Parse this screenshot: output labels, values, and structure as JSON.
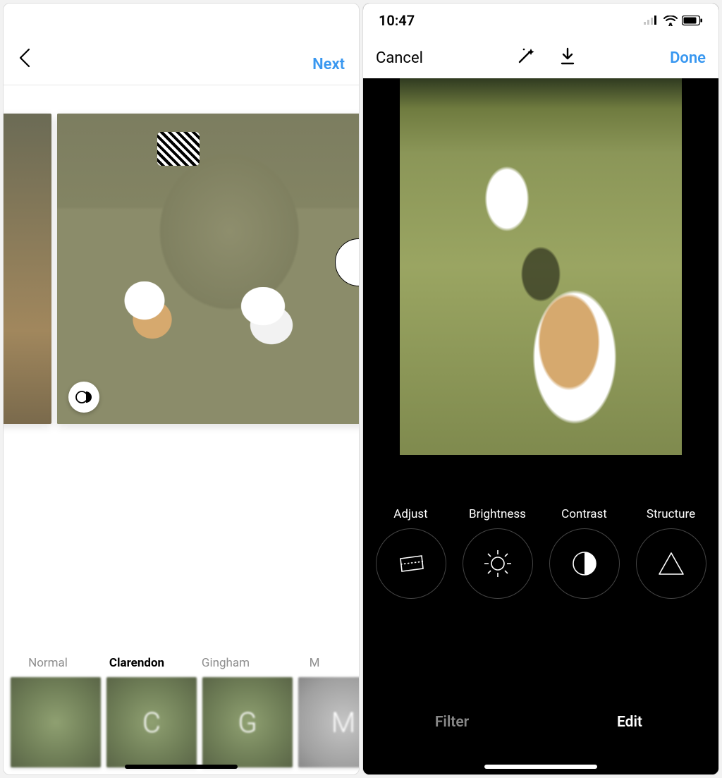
{
  "left": {
    "header": {
      "next": "Next"
    },
    "filters": [
      {
        "label": "Normal",
        "glyph": "",
        "active": false
      },
      {
        "label": "Clarendon",
        "glyph": "C",
        "active": true
      },
      {
        "label": "Gingham",
        "glyph": "G",
        "active": false
      },
      {
        "label": "M",
        "glyph": "M",
        "active": false
      }
    ]
  },
  "right": {
    "status": {
      "time": "10:47"
    },
    "header": {
      "cancel": "Cancel",
      "done": "Done"
    },
    "tools": [
      {
        "label": "Adjust"
      },
      {
        "label": "Brightness"
      },
      {
        "label": "Contrast"
      },
      {
        "label": "Structure"
      }
    ],
    "tabs": {
      "filter": "Filter",
      "edit": "Edit",
      "active": "edit"
    }
  },
  "colors": {
    "accent": "#3897f0"
  }
}
